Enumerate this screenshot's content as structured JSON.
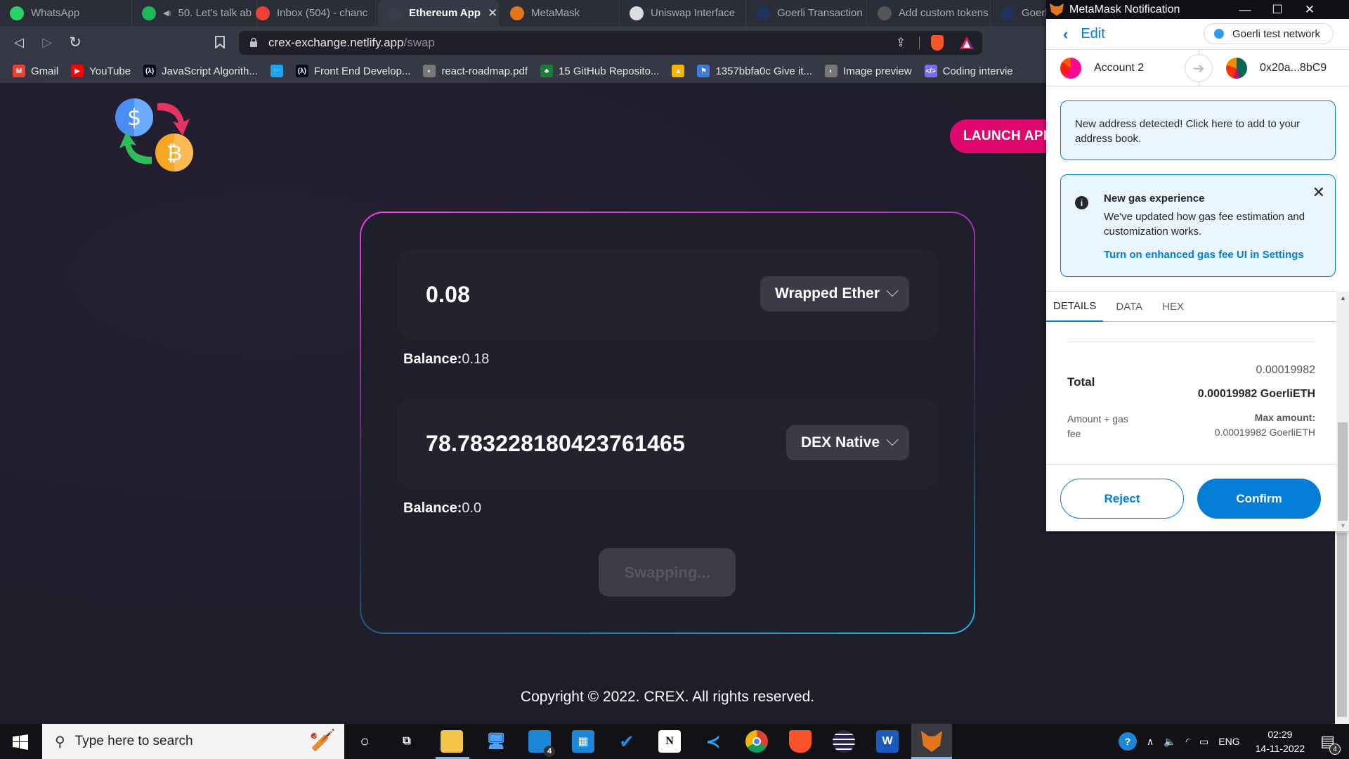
{
  "browser": {
    "tabs": [
      {
        "label": "WhatsApp",
        "icon": "whatsapp-icon",
        "color": "#25d366"
      },
      {
        "label": "50. Let's talk ab",
        "icon": "spotify-icon",
        "color": "#1db954",
        "audio": true
      },
      {
        "label": "Inbox (504) - chanc",
        "icon": "gmail-icon",
        "color": "#ea4335"
      },
      {
        "label": "Ethereum App",
        "icon": "ethereum-icon",
        "color": "#3a3c48",
        "active": true,
        "close": "✕"
      },
      {
        "label": "MetaMask",
        "icon": "metamask-icon",
        "color": "#e2761b"
      },
      {
        "label": "Uniswap Interface",
        "icon": "uniswap-icon",
        "color": "#ddd"
      },
      {
        "label": "Goerli Transaction H",
        "icon": "etherscan-icon",
        "color": "#21325b"
      },
      {
        "label": "Add custom tokens",
        "icon": "screenshot-icon",
        "color": "#555"
      },
      {
        "label": "Goerli",
        "icon": "etherscan-icon",
        "color": "#21325b"
      }
    ],
    "url_host": "crex-exchange.netlify.app",
    "url_path": "/swap",
    "bookmarks": [
      {
        "label": "Gmail",
        "icon": "gmail-icon",
        "color": "#ea4335",
        "glyph": "M"
      },
      {
        "label": "YouTube",
        "icon": "youtube-icon",
        "color": "#ff0000",
        "glyph": "▶"
      },
      {
        "label": "JavaScript Algorith...",
        "icon": "fcc-icon",
        "color": "#0a0a23",
        "glyph": "(λ)"
      },
      {
        "label": "",
        "icon": "twitter-icon",
        "color": "#1da1f2",
        "glyph": "🐦"
      },
      {
        "label": "Front End Develop...",
        "icon": "fcc-icon",
        "color": "#0a0a23",
        "glyph": "(λ)"
      },
      {
        "label": "react-roadmap.pdf",
        "icon": "globe-icon",
        "color": "#777",
        "glyph": "◐"
      },
      {
        "label": "15 GitHub Reposito...",
        "icon": "tree-icon",
        "color": "#1f7a3a",
        "glyph": "♣"
      },
      {
        "label": "",
        "icon": "google-drive-icon",
        "color": "#f4b400",
        "glyph": "▲"
      },
      {
        "label": "1357bbfa0c Give it...",
        "icon": "flag-icon",
        "color": "#3b7dd8",
        "glyph": "⚑"
      },
      {
        "label": "Image preview",
        "icon": "globe-icon",
        "color": "#777",
        "glyph": "◐"
      },
      {
        "label": "Coding intervie",
        "icon": "code-icon",
        "color": "#7b6cf6",
        "glyph": "</>"
      }
    ]
  },
  "app": {
    "launch_label": "LAUNCH APP",
    "from": {
      "amount": "0.08",
      "token": "Wrapped Ether",
      "balance_label": "Balance:",
      "balance": "0.18"
    },
    "to": {
      "amount": "78.783228180423761465",
      "token": "DEX Native",
      "balance_label": "Balance:",
      "balance": "0.0"
    },
    "swap_label": "Swapping...",
    "copyright": "Copyright © 2022. CREX. All rights reserved."
  },
  "metamask": {
    "window_title": "MetaMask Notification",
    "edit_label": "Edit",
    "network": "Goerli test network",
    "from_account": "Account 2",
    "to_address": "0x20a...8bC9",
    "address_alert": "New address detected! Click here to add to your address book.",
    "gas_alert": {
      "title": "New gas experience",
      "description": "We've updated how gas fee estimation and customization works.",
      "link": "Turn on enhanced gas fee UI in Settings"
    },
    "tabs": [
      "DETAILS",
      "DATA",
      "HEX"
    ],
    "total_label": "Total",
    "total_secondary": "0.00019982",
    "total_primary": "0.00019982 GoerliETH",
    "amount_gas_label": "Amount + gas fee",
    "max_amount_label": "Max amount:",
    "max_amount_value": "0.00019982 GoerliETH",
    "reject_label": "Reject",
    "confirm_label": "Confirm"
  },
  "taskbar": {
    "search_placeholder": "Type here to search",
    "mail_badge": "4",
    "language": "ENG",
    "time": "02:29",
    "date": "14-11-2022",
    "notification_count": "4"
  }
}
